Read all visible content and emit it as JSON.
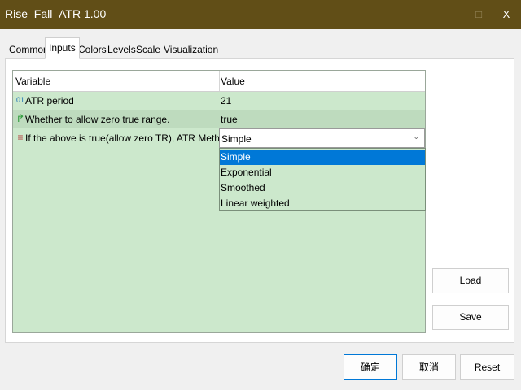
{
  "window": {
    "title": "Rise_Fall_ATR 1.00",
    "minimize_glyph": "–",
    "maximize_glyph": "□",
    "close_glyph": "X"
  },
  "tabs": [
    "Common",
    "Inputs",
    "Colors",
    "Levels",
    "Scale",
    "Visualization"
  ],
  "active_tab": "Inputs",
  "grid": {
    "headers": {
      "variable": "Variable",
      "value": "Value"
    },
    "rows": [
      {
        "icon": "integer-icon",
        "icon_glyph": "01",
        "name": "ATR period",
        "value": "21"
      },
      {
        "icon": "boolean-icon",
        "icon_glyph": "↱",
        "name": "Whether to allow zero true range.",
        "value": "true"
      },
      {
        "icon": "enum-icon",
        "icon_glyph": "≡",
        "name": "If the above is true(allow zero TR), ATR Method.",
        "value": "Simple"
      }
    ]
  },
  "dropdown": {
    "selected": "Simple",
    "arrow_glyph": "⌄",
    "options": [
      "Simple",
      "Exponential",
      "Smoothed",
      "Linear weighted"
    ]
  },
  "side_buttons": {
    "load": "Load",
    "save": "Save"
  },
  "footer": {
    "ok": "确定",
    "cancel": "取消",
    "reset": "Reset"
  },
  "colors": {
    "titlebar": "#614e17",
    "grid_background": "#cce8cc",
    "selection": "#0078d7"
  }
}
